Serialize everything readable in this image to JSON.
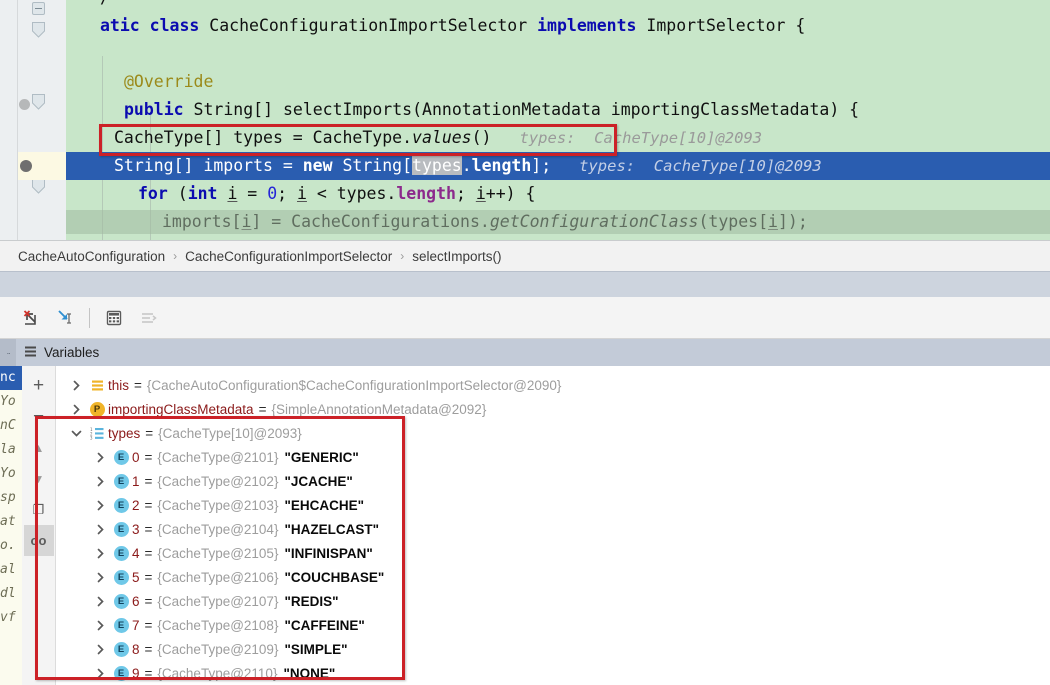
{
  "editor": {
    "lines": [
      {
        "id": "l0",
        "tokens": [
          {
            "t": "/",
            "c": "plain"
          }
        ]
      },
      {
        "id": "l1",
        "tokens": [
          {
            "t": "atic ",
            "c": "kw-b"
          },
          {
            "t": "class ",
            "c": "kw"
          },
          {
            "t": "CacheConfigurationImportSelector ",
            "c": "plain"
          },
          {
            "t": "implements ",
            "c": "kw"
          },
          {
            "t": "ImportSelector {",
            "c": "plain"
          }
        ]
      },
      {
        "id": "l2",
        "tokens": []
      },
      {
        "id": "l3",
        "tokens": [
          {
            "t": "@Override",
            "c": "anno"
          }
        ]
      },
      {
        "id": "l4",
        "tokens": [
          {
            "t": "public ",
            "c": "kw"
          },
          {
            "t": "String[] selectImports(AnnotationMetadata importingClassMetadata) {",
            "c": "plain"
          }
        ]
      },
      {
        "id": "l5",
        "tokens": [
          {
            "t": "CacheType[] types = CacheType.",
            "c": "plain"
          },
          {
            "t": "values",
            "c": "mtd"
          },
          {
            "t": "()",
            "c": "plain"
          }
        ],
        "hint": "types:  CacheType[10]@2093"
      },
      {
        "id": "l6",
        "tokens": [
          {
            "t": "String[] imports = ",
            "c": "plain"
          },
          {
            "t": "new ",
            "c": "kw"
          },
          {
            "t": "String[",
            "c": "plain"
          },
          {
            "t": "types",
            "c": "sel"
          },
          {
            "t": ".",
            "c": "plain"
          },
          {
            "t": "length",
            "c": "field"
          },
          {
            "t": "];",
            "c": "plain"
          }
        ],
        "hint": "types:  CacheType[10]@2093",
        "executing": true
      },
      {
        "id": "l7",
        "tokens": [
          {
            "t": "for ",
            "c": "kw"
          },
          {
            "t": "(",
            "c": "plain"
          },
          {
            "t": "int ",
            "c": "kw"
          },
          {
            "t": "i",
            "c": "varu"
          },
          {
            "t": " = ",
            "c": "plain"
          },
          {
            "t": "0",
            "c": "num"
          },
          {
            "t": "; ",
            "c": "plain"
          },
          {
            "t": "i",
            "c": "varu"
          },
          {
            "t": " < types.",
            "c": "plain"
          },
          {
            "t": "length",
            "c": "field"
          },
          {
            "t": "; ",
            "c": "plain"
          },
          {
            "t": "i",
            "c": "varu"
          },
          {
            "t": "++) {",
            "c": "plain"
          }
        ]
      },
      {
        "id": "l8",
        "tokens": [
          {
            "t": "imports[",
            "c": "plain"
          },
          {
            "t": "i",
            "c": "varu"
          },
          {
            "t": "] = CacheConfigurations.",
            "c": "plain"
          },
          {
            "t": "getConfigurationClass",
            "c": "mtd"
          },
          {
            "t": "(types[",
            "c": "plain"
          },
          {
            "t": "i",
            "c": "varu"
          },
          {
            "t": "]);",
            "c": "plain"
          }
        ]
      }
    ]
  },
  "breadcrumb": {
    "items": [
      "CacheAutoConfiguration",
      "CacheConfigurationImportSelector",
      "selectImports()"
    ],
    "separator": "›"
  },
  "toolbar": {
    "buttons": [
      {
        "name": "step-out-icon",
        "title": "Step Out",
        "enabled": true
      },
      {
        "name": "force-step-into-icon",
        "title": "Force Step Into",
        "enabled": true
      },
      {
        "name": "evaluate-expression-icon",
        "title": "Evaluate Expression",
        "enabled": true
      },
      {
        "name": "settings-lines-icon",
        "title": "Layout Settings",
        "enabled": false
      }
    ]
  },
  "variables_panel": {
    "tab_label": "Variables",
    "side_buttons": [
      {
        "name": "add-watch-icon",
        "glyph": "+",
        "active": false
      },
      {
        "name": "remove-watch-icon",
        "glyph": "−",
        "active": false
      },
      {
        "name": "move-up-icon",
        "glyph": "▲",
        "active": false
      },
      {
        "name": "move-down-icon",
        "glyph": "▼",
        "active": false
      },
      {
        "name": "copy-value-icon",
        "glyph": "❐",
        "active": false
      },
      {
        "name": "inspect-icon",
        "glyph": "oo",
        "active": true
      }
    ],
    "tree": [
      {
        "depth": 0,
        "twisty": "collapsed",
        "icon": "object-lines",
        "name": "this",
        "ref": "{CacheAutoConfiguration$CacheConfigurationImportSelector@2090}",
        "value": ""
      },
      {
        "depth": 0,
        "twisty": "collapsed",
        "icon": "param-p",
        "name": "importingClassMetadata",
        "ref": "{SimpleAnnotationMetadata@2092}",
        "value": ""
      },
      {
        "depth": 0,
        "twisty": "expanded",
        "icon": "array-123",
        "name": "types",
        "ref": "{CacheType[10]@2093}",
        "value": ""
      },
      {
        "depth": 1,
        "twisty": "collapsed",
        "icon": "enum-e",
        "name": "0",
        "ref": "{CacheType@2101}",
        "value": "\"GENERIC\""
      },
      {
        "depth": 1,
        "twisty": "collapsed",
        "icon": "enum-e",
        "name": "1",
        "ref": "{CacheType@2102}",
        "value": "\"JCACHE\""
      },
      {
        "depth": 1,
        "twisty": "collapsed",
        "icon": "enum-e",
        "name": "2",
        "ref": "{CacheType@2103}",
        "value": "\"EHCACHE\""
      },
      {
        "depth": 1,
        "twisty": "collapsed",
        "icon": "enum-e",
        "name": "3",
        "ref": "{CacheType@2104}",
        "value": "\"HAZELCAST\""
      },
      {
        "depth": 1,
        "twisty": "collapsed",
        "icon": "enum-e",
        "name": "4",
        "ref": "{CacheType@2105}",
        "value": "\"INFINISPAN\""
      },
      {
        "depth": 1,
        "twisty": "collapsed",
        "icon": "enum-e",
        "name": "5",
        "ref": "{CacheType@2106}",
        "value": "\"COUCHBASE\""
      },
      {
        "depth": 1,
        "twisty": "collapsed",
        "icon": "enum-e",
        "name": "6",
        "ref": "{CacheType@2107}",
        "value": "\"REDIS\""
      },
      {
        "depth": 1,
        "twisty": "collapsed",
        "icon": "enum-e",
        "name": "7",
        "ref": "{CacheType@2108}",
        "value": "\"CAFFEINE\""
      },
      {
        "depth": 1,
        "twisty": "collapsed",
        "icon": "enum-e",
        "name": "8",
        "ref": "{CacheType@2109}",
        "value": "\"SIMPLE\""
      },
      {
        "depth": 1,
        "twisty": "collapsed",
        "icon": "enum-e",
        "name": "9",
        "ref": "{CacheType@2110}",
        "value": "\"NONE\""
      }
    ]
  },
  "ghost_code_strip": {
    "lines": [
      "nc",
      "Yo",
      "nC",
      "la",
      "Yo",
      "sp",
      "at",
      "o.",
      "",
      "al",
      "dl",
      "vf"
    ],
    "highlight_index": 0
  },
  "annotations": [
    {
      "name": "code-highlight-box",
      "color": "#cc2127"
    },
    {
      "name": "variables-highlight-box",
      "color": "#cc2127"
    }
  ],
  "colors": {
    "editor_background": "#c8e6c9",
    "execution_line": "#2a5db0",
    "annotation_red": "#cc2127",
    "panel_header": "#c3cbd8"
  }
}
